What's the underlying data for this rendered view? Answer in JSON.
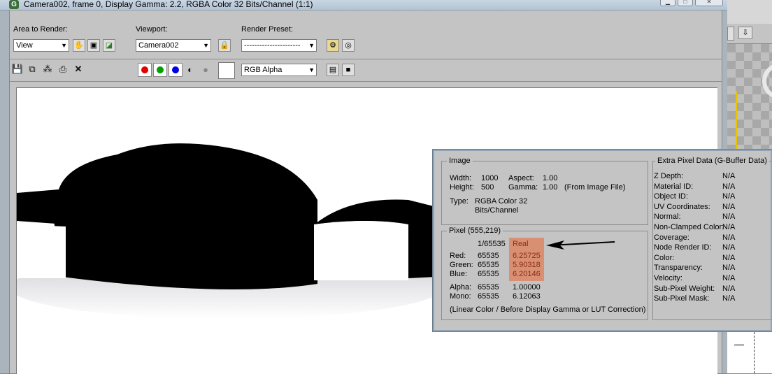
{
  "window": {
    "title": "Camera002, frame 0, Display Gamma: 2.2, RGBA Color 32 Bits/Channel (1:1)",
    "app_icon": "G"
  },
  "toolbar": {
    "area_label": "Area to Render:",
    "area_value": "View",
    "viewport_label": "Viewport:",
    "viewport_value": "Camera002",
    "preset_label": "Render Preset:",
    "preset_value": "----------------------",
    "channel_value": "RGB Alpha"
  },
  "colors": {
    "red_channel": "#e00000",
    "green_channel": "#00a000",
    "blue_channel": "#0000e0",
    "highlight": "#d99072"
  },
  "info": {
    "image_group": "Image",
    "width_label": "Width:",
    "width_value": "1000",
    "height_label": "Height:",
    "height_value": "500",
    "aspect_label": "Aspect:",
    "aspect_value": "1.00",
    "gamma_label": "Gamma:",
    "gamma_value": "1.00",
    "gamma_note": "(From Image File)",
    "type_label": "Type:",
    "type_value_line1": "RGBA Color 32",
    "type_value_line2": "Bits/Channel",
    "pixel_group": "Pixel (555,219)",
    "col_int_header": "1/65535",
    "col_real_header": "Real",
    "red_label": "Red:",
    "red_int": "65535",
    "red_real": "6.25725",
    "green_label": "Green:",
    "green_int": "65535",
    "green_real": "5.90318",
    "blue_label": "Blue:",
    "blue_int": "65535",
    "blue_real": "6.20146",
    "alpha_label": "Alpha:",
    "alpha_int": "65535",
    "alpha_real": "1.00000",
    "mono_label": "Mono:",
    "mono_int": "65535",
    "mono_real": "6.12063",
    "linear_note": "(Linear Color / Before Display Gamma or LUT Correction)",
    "extra_group": "Extra Pixel Data (G-Buffer Data)",
    "extra_rows": [
      {
        "label": "Z Depth:",
        "value": "N/A"
      },
      {
        "label": "Material ID:",
        "value": "N/A"
      },
      {
        "label": "Object ID:",
        "value": "N/A"
      },
      {
        "label": "UV Coordinates:",
        "value": "N/A"
      },
      {
        "label": "Normal:",
        "value": "N/A"
      },
      {
        "label": "Non-Clamped Color:",
        "value": "N/A"
      },
      {
        "label": "Coverage:",
        "value": "N/A"
      },
      {
        "label": "Node Render ID:",
        "value": "N/A"
      },
      {
        "label": "Color:",
        "value": "N/A"
      },
      {
        "label": "Transparency:",
        "value": "N/A"
      },
      {
        "label": "Velocity:",
        "value": "N/A"
      },
      {
        "label": "Sub-Pixel Weight:",
        "value": "N/A"
      },
      {
        "label": "Sub-Pixel Mask:",
        "value": "N/A"
      }
    ]
  }
}
